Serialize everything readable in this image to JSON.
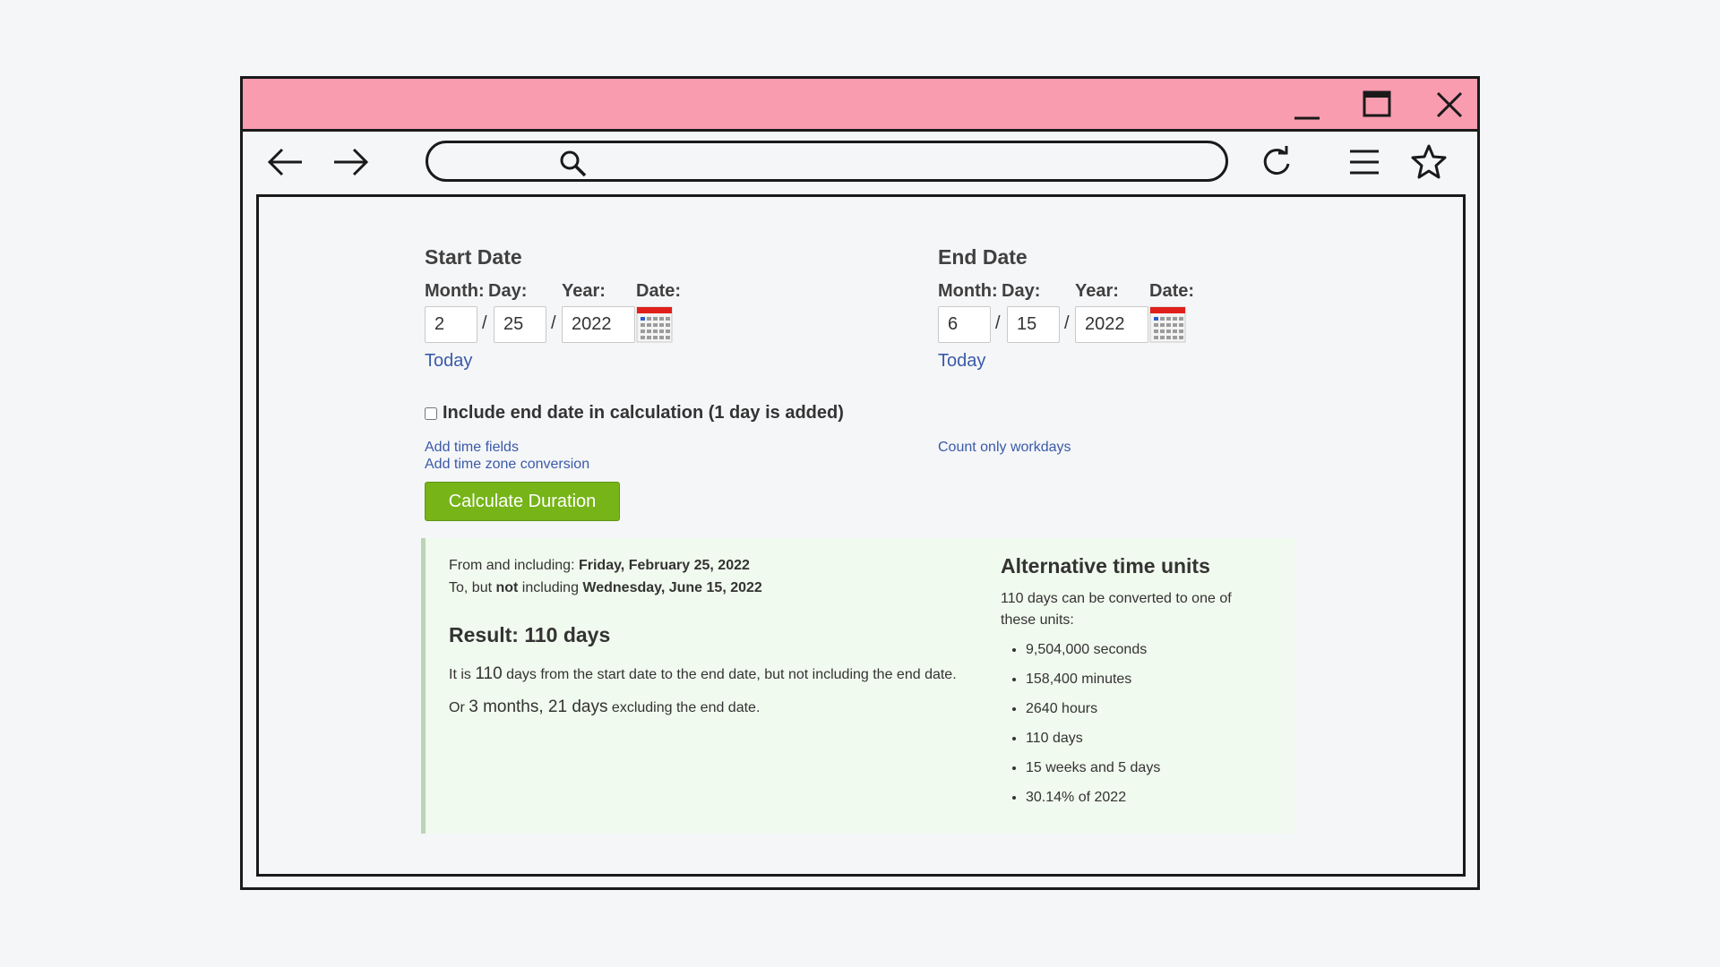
{
  "window_controls": {
    "minimize": "minimize-icon",
    "maximize": "maximize-icon",
    "close": "close-icon"
  },
  "toolbar": {
    "address_value": "",
    "icons": [
      "back-arrow-icon",
      "forward-arrow-icon",
      "search-icon",
      "reload-icon",
      "menu-icon",
      "star-icon"
    ]
  },
  "start": {
    "heading": "Start Date",
    "month_label": "Month:",
    "day_label": "Day:",
    "year_label": "Year:",
    "date_label": "Date:",
    "month": "2",
    "day": "25",
    "year": "2022",
    "sep": "/",
    "today": "Today"
  },
  "end": {
    "heading": "End Date",
    "month_label": "Month:",
    "day_label": "Day:",
    "year_label": "Year:",
    "date_label": "Date:",
    "month": "6",
    "day": "15",
    "year": "2022",
    "sep": "/",
    "today": "Today"
  },
  "include_end_label": "Include end date in calculation (1 day is added)",
  "include_end_checked": false,
  "links": {
    "time_fields": "Add time fields",
    "time_zone": "Add time zone conversion",
    "workdays": "Count only workdays"
  },
  "calculate_label": "Calculate Duration",
  "result": {
    "from_prefix": "From and including: ",
    "from_date": "Friday, February 25, 2022",
    "to_prefix": "To, but ",
    "to_not": "not",
    "to_mid": " including ",
    "to_date": "Wednesday, June 15, 2022",
    "heading": "Result: 110 days",
    "sentence1_pre": "It is ",
    "sentence1_num": "110",
    "sentence1_post": " days from the start date to the end date, but not including the end date.",
    "sentence2_pre": "Or ",
    "sentence2_num": "3 months, 21 days",
    "sentence2_post": " excluding the end date."
  },
  "alternative": {
    "heading": "Alternative time units",
    "intro": "110 days can be converted to one of these units:",
    "units": [
      "9,504,000 seconds",
      "158,400 minutes",
      "2640 hours",
      "110 days",
      "15 weeks and 5 days",
      "30.14% of 2022"
    ]
  },
  "colors": {
    "titlebar": "#f99cb0",
    "button_green": "#76b418",
    "link_blue": "#3a5aa8",
    "result_bg": "#f1faee"
  }
}
